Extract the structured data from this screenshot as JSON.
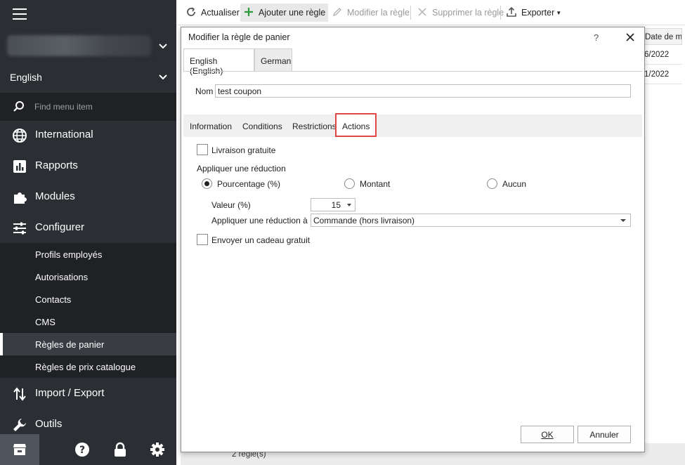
{
  "sidebar": {
    "language": "English",
    "search_placeholder": "Find menu item",
    "nav": [
      {
        "label": "International",
        "icon": "globe-icon"
      },
      {
        "label": "Rapports",
        "icon": "bar-chart-icon"
      },
      {
        "label": "Modules",
        "icon": "puzzle-icon"
      },
      {
        "label": "Configurer",
        "icon": "sliders-icon"
      },
      {
        "label": "Import / Export",
        "icon": "import-export-icon"
      },
      {
        "label": "Outils",
        "icon": "wrench-icon"
      }
    ],
    "sub_items": [
      {
        "label": "Profils employés"
      },
      {
        "label": "Autorisations"
      },
      {
        "label": "Contacts"
      },
      {
        "label": "CMS"
      },
      {
        "label": "Règles de panier"
      },
      {
        "label": "Règles de prix catalogue"
      }
    ],
    "active_sub_item": "Règles de panier"
  },
  "toolbar": {
    "refresh": "Actualiser",
    "add": "Ajouter une règle",
    "edit": "Modifier la règle",
    "delete": "Supprimer la règle",
    "export": "Exporter"
  },
  "grid": {
    "header": "Date de m",
    "rows": [
      "6/2022",
      "1/2022"
    ],
    "status": "2 règle(s)"
  },
  "dialog": {
    "title": "Modifier la règle de panier",
    "help": "?",
    "language_tabs": [
      "English (English)",
      "German"
    ],
    "name_label": "Nom",
    "name_value": "test coupon",
    "tabs": [
      "Information",
      "Conditions",
      "Restrictions",
      "Actions"
    ],
    "active_tab": "Actions",
    "free_shipping_label": "Livraison gratuite",
    "free_shipping_checked": false,
    "discount_group_label": "Appliquer une réduction",
    "discount_options": [
      "Pourcentage (%)",
      "Montant",
      "Aucun"
    ],
    "discount_selected": "Pourcentage (%)",
    "value_label": "Valeur (%)",
    "value": "15",
    "apply_to_label": "Appliquer une réduction à",
    "apply_to_value": "Commande (hors livraison)",
    "gift_label": "Envoyer un cadeau gratuit",
    "gift_checked": false,
    "ok": "OK",
    "cancel": "Annuler"
  },
  "colors": {
    "sidebar_bg": "#2b2e33",
    "sidebar_sub_bg": "#1f2125",
    "active_tab_outline": "#e04848",
    "add_icon": "#2e9b3e"
  }
}
